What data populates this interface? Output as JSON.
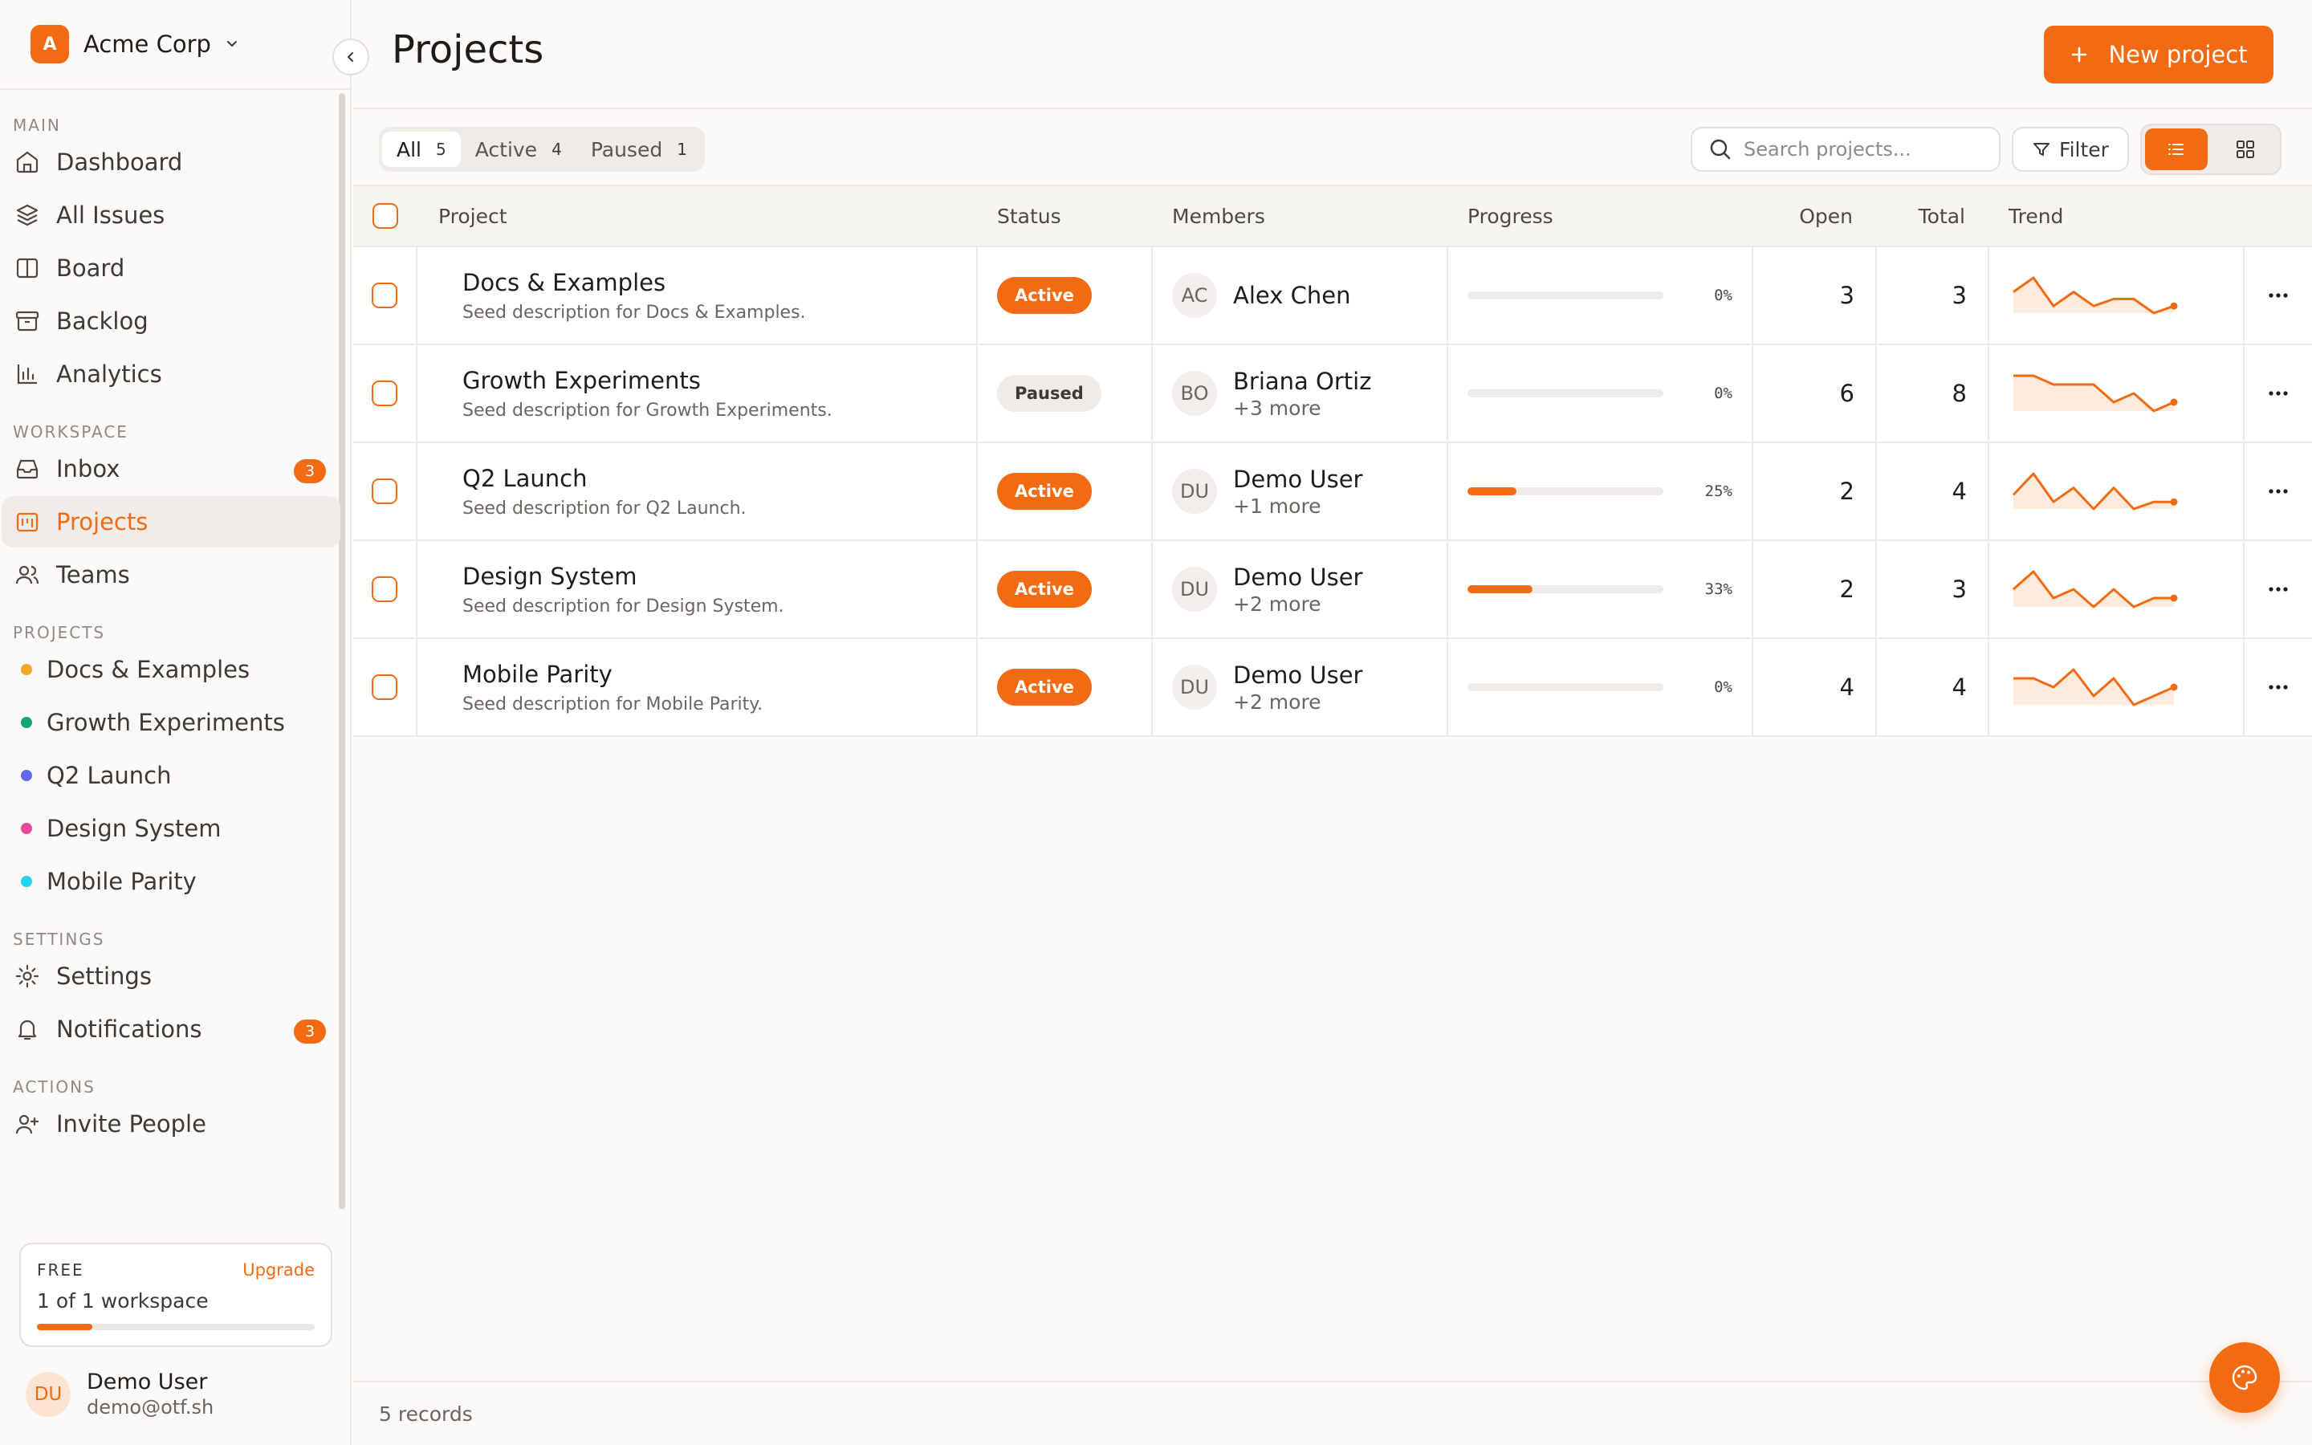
{
  "workspace": {
    "initial": "A",
    "name": "Acme Corp"
  },
  "sidebar": {
    "sections": [
      {
        "label": "MAIN",
        "items": [
          {
            "label": "Dashboard",
            "icon": "home-icon"
          },
          {
            "label": "All Issues",
            "icon": "layers-icon"
          },
          {
            "label": "Board",
            "icon": "board-icon"
          },
          {
            "label": "Backlog",
            "icon": "archive-icon"
          },
          {
            "label": "Analytics",
            "icon": "bar-chart-icon"
          }
        ]
      },
      {
        "label": "WORKSPACE",
        "items": [
          {
            "label": "Inbox",
            "icon": "inbox-icon",
            "badge": "3"
          },
          {
            "label": "Projects",
            "icon": "projects-icon",
            "active": true
          },
          {
            "label": "Teams",
            "icon": "users-icon"
          }
        ]
      },
      {
        "label": "PROJECTS",
        "items": [
          {
            "label": "Docs & Examples",
            "color": "#f5a524"
          },
          {
            "label": "Growth Experiments",
            "color": "#17a673"
          },
          {
            "label": "Q2 Launch",
            "color": "#6366f1"
          },
          {
            "label": "Design System",
            "color": "#ec4899"
          },
          {
            "label": "Mobile Parity",
            "color": "#22d3ee"
          }
        ]
      },
      {
        "label": "SETTINGS",
        "items": [
          {
            "label": "Settings",
            "icon": "gear-icon"
          },
          {
            "label": "Notifications",
            "icon": "bell-icon",
            "badge": "3"
          }
        ]
      },
      {
        "label": "ACTIONS",
        "items": [
          {
            "label": "Invite People",
            "icon": "user-plus-icon"
          }
        ]
      }
    ],
    "plan": {
      "name": "FREE",
      "upgrade_label": "Upgrade",
      "usage": "1 of 1 workspace",
      "fill": 0.2
    },
    "user": {
      "initials": "DU",
      "name": "Demo User",
      "email": "demo@otf.sh"
    }
  },
  "header": {
    "title": "Projects",
    "new_button": "New project"
  },
  "toolbar": {
    "tabs": [
      {
        "label": "All",
        "count": "5",
        "active": true
      },
      {
        "label": "Active",
        "count": "4"
      },
      {
        "label": "Paused",
        "count": "1"
      }
    ],
    "search_placeholder": "Search projects...",
    "filter_label": "Filter"
  },
  "table": {
    "columns": {
      "project": "Project",
      "status": "Status",
      "members": "Members",
      "progress": "Progress",
      "open": "Open",
      "total": "Total",
      "trend": "Trend"
    },
    "rows": [
      {
        "name": "Docs & Examples",
        "desc": "Seed description for Docs & Examples.",
        "status": "Active",
        "status_kind": "active",
        "member_initials": "AC",
        "member_name": "Alex Chen",
        "member_more": "",
        "progress": 0,
        "progress_label": "0%",
        "open": "3",
        "total": "3",
        "trend": [
          3,
          5,
          1,
          3,
          1,
          2,
          2,
          0,
          1
        ]
      },
      {
        "name": "Growth Experiments",
        "desc": "Seed description for Growth Experiments.",
        "status": "Paused",
        "status_kind": "paused",
        "member_initials": "BO",
        "member_name": "Briana Ortiz",
        "member_more": "+3 more",
        "progress": 0,
        "progress_label": "0%",
        "open": "6",
        "total": "8",
        "trend": [
          4,
          4,
          3,
          3,
          3,
          1,
          2,
          0,
          1
        ]
      },
      {
        "name": "Q2 Launch",
        "desc": "Seed description for Q2 Launch.",
        "status": "Active",
        "status_kind": "active",
        "member_initials": "DU",
        "member_name": "Demo User",
        "member_more": "+1 more",
        "progress": 25,
        "progress_label": "25%",
        "open": "2",
        "total": "4",
        "trend": [
          2,
          5,
          1,
          3,
          0,
          3,
          0,
          1,
          1
        ]
      },
      {
        "name": "Design System",
        "desc": "Seed description for Design System.",
        "status": "Active",
        "status_kind": "active",
        "member_initials": "DU",
        "member_name": "Demo User",
        "member_more": "+2 more",
        "progress": 33,
        "progress_label": "33%",
        "open": "2",
        "total": "3",
        "trend": [
          2,
          4,
          1,
          2,
          0,
          2,
          0,
          1,
          1
        ]
      },
      {
        "name": "Mobile Parity",
        "desc": "Seed description for Mobile Parity.",
        "status": "Active",
        "status_kind": "active",
        "member_initials": "DU",
        "member_name": "Demo User",
        "member_more": "+2 more",
        "progress": 0,
        "progress_label": "0%",
        "open": "4",
        "total": "4",
        "trend": [
          3,
          3,
          2,
          4,
          1,
          3,
          0,
          1,
          2
        ]
      }
    ]
  },
  "footer": {
    "records": "5 records"
  },
  "colors": {
    "accent": "#f26b12",
    "accent_soft": "#fde4d2"
  }
}
